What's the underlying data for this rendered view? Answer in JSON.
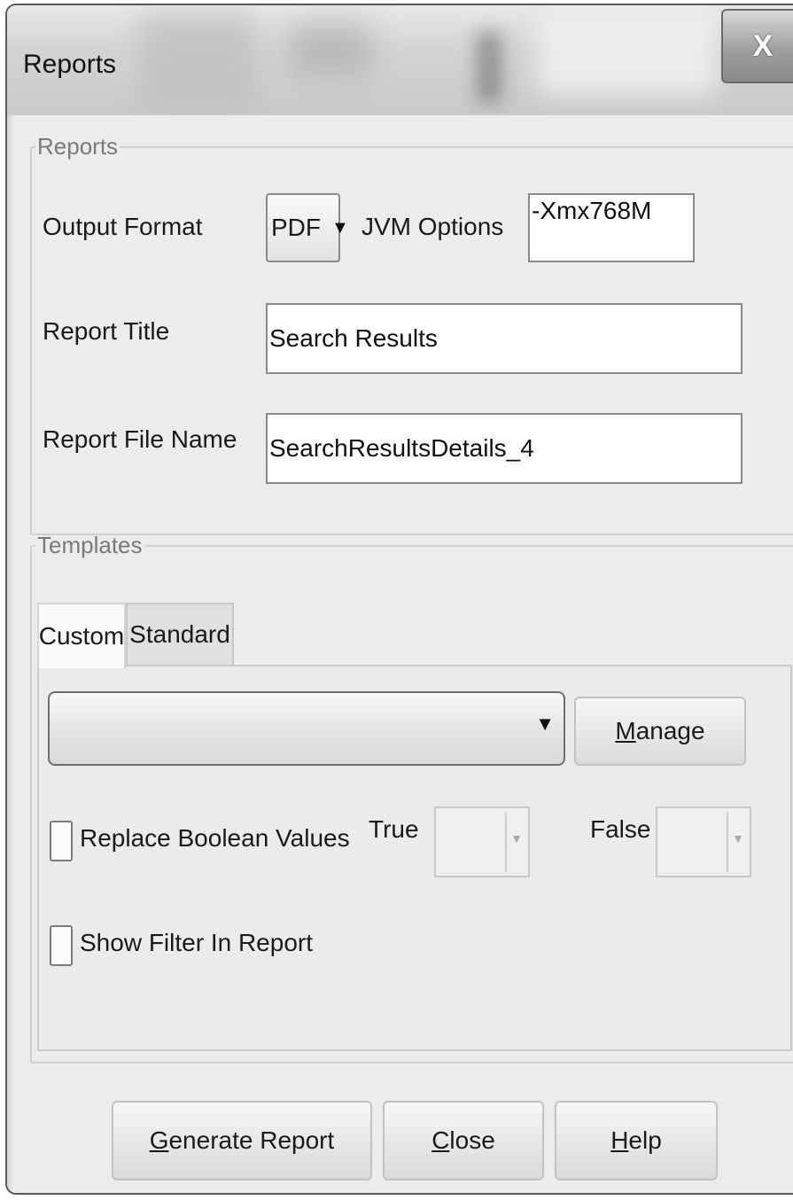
{
  "window": {
    "title": "Reports",
    "close_glyph": "X"
  },
  "reports_group": {
    "legend": "Reports",
    "output_format": {
      "label": "Output Format",
      "value": "PDF",
      "arrow": "▼"
    },
    "jvm_options": {
      "label": "JVM Options",
      "value": "-Xmx768M"
    },
    "report_title": {
      "label": "Report Title",
      "value": "Search Results"
    },
    "report_file_name": {
      "label": "Report File Name",
      "value": "SearchResultsDetails_4"
    }
  },
  "templates_group": {
    "legend": "Templates",
    "tabs": [
      {
        "label": "Custom",
        "active": true
      },
      {
        "label": "Standard",
        "active": false
      }
    ],
    "template_combo": {
      "value": "",
      "arrow": "▼"
    },
    "manage_button": {
      "mnemonic": "M",
      "rest": "anage"
    },
    "replace_boolean": {
      "label": "Replace Boolean Values",
      "checked": false
    },
    "true_label": "True",
    "false_label": "False",
    "small_arrow": "▼",
    "show_filter": {
      "label": "Show Filter In Report",
      "checked": false
    }
  },
  "buttons": {
    "generate": {
      "mnemonic": "G",
      "rest": "enerate Report"
    },
    "close": {
      "mnemonic": "C",
      "rest": "lose"
    },
    "help": {
      "mnemonic": "H",
      "rest": "elp"
    }
  }
}
